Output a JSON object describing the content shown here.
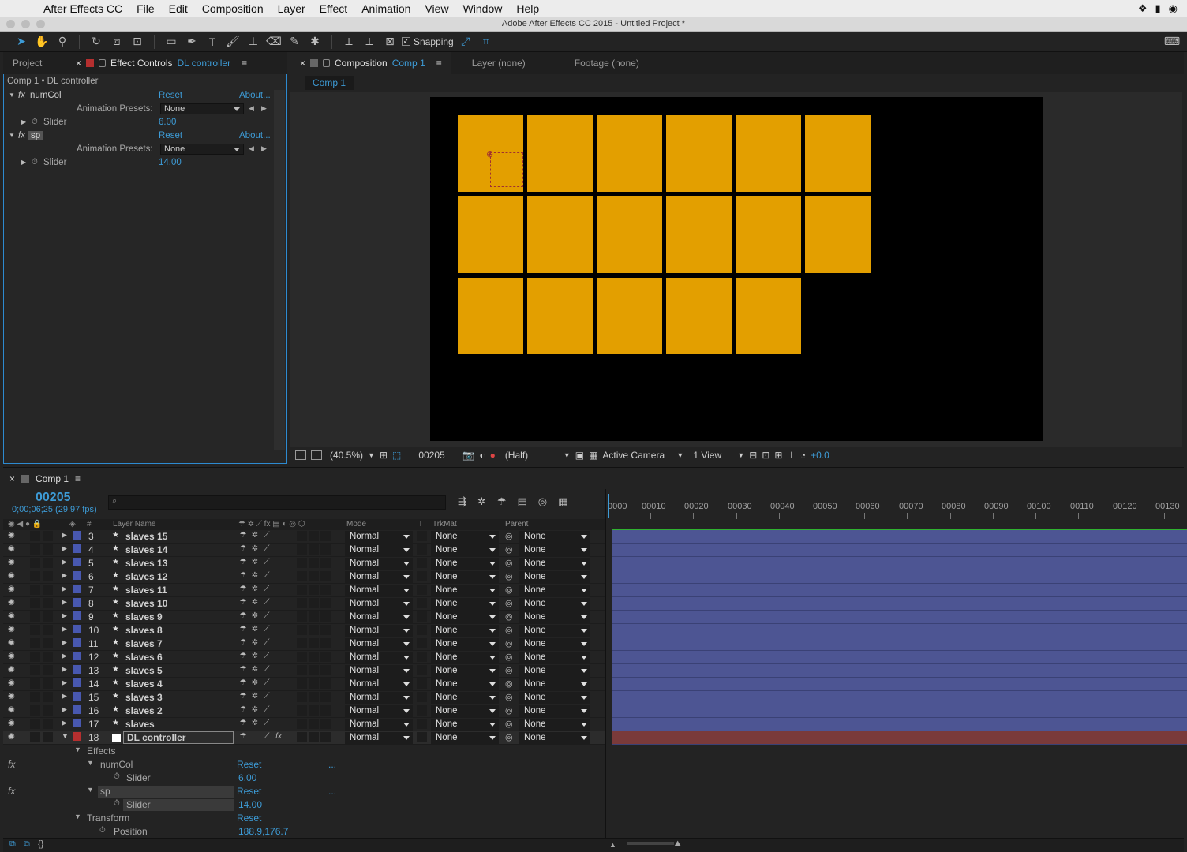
{
  "menubar": {
    "app": "After Effects CC",
    "items": [
      "File",
      "Edit",
      "Composition",
      "Layer",
      "Effect",
      "Animation",
      "View",
      "Window",
      "Help"
    ]
  },
  "window_title": "Adobe After Effects CC 2015 - Untitled Project *",
  "toolbar": {
    "snapping_label": "Snapping",
    "snapping_checked": true
  },
  "left_panel": {
    "tab_project": "Project",
    "tab_effect_controls": "Effect Controls",
    "tab_effect_controls_target": "DL controller",
    "breadcrumb": "Comp 1 • DL controller",
    "effects": [
      {
        "name": "numCol",
        "reset": "Reset",
        "about": "About...",
        "presets_label": "Animation Presets:",
        "preset_value": "None",
        "param_name": "Slider",
        "param_value": "6.00"
      },
      {
        "name": "sp",
        "reset": "Reset",
        "about": "About...",
        "presets_label": "Animation Presets:",
        "preset_value": "None",
        "param_name": "Slider",
        "param_value": "14.00"
      }
    ]
  },
  "comp_panel": {
    "tab_label": "Composition",
    "tab_target": "Comp 1",
    "tab_layer": "Layer (none)",
    "tab_footage": "Footage (none)",
    "flow_button": "Comp 1",
    "tile_color": "#e39f00",
    "footer": {
      "zoom": "(40.5%)",
      "frame": "00205",
      "resolution": "(Half)",
      "camera": "Active Camera",
      "views": "1 View",
      "exposure": "+0.0"
    }
  },
  "timeline": {
    "tab": "Comp 1",
    "timecode": "00205",
    "fps_text": "0;00;06;25 (29.97 fps)",
    "search_placeholder": "⌕",
    "columns": {
      "layer_name": "Layer Name",
      "num": "#",
      "mode": "Mode",
      "t": "T",
      "trkmat": "TrkMat",
      "parent": "Parent"
    },
    "ruler": [
      "0000",
      "00010",
      "00020",
      "00030",
      "00040",
      "00050",
      "00060",
      "00070",
      "00080",
      "00090",
      "00100",
      "00110",
      "00120",
      "00130"
    ],
    "layers": [
      {
        "num": "3",
        "name": "slaves 15",
        "mode": "Normal",
        "trkmat": "None",
        "parent": "None"
      },
      {
        "num": "4",
        "name": "slaves 14",
        "mode": "Normal",
        "trkmat": "None",
        "parent": "None"
      },
      {
        "num": "5",
        "name": "slaves 13",
        "mode": "Normal",
        "trkmat": "None",
        "parent": "None"
      },
      {
        "num": "6",
        "name": "slaves 12",
        "mode": "Normal",
        "trkmat": "None",
        "parent": "None"
      },
      {
        "num": "7",
        "name": "slaves 11",
        "mode": "Normal",
        "trkmat": "None",
        "parent": "None"
      },
      {
        "num": "8",
        "name": "slaves 10",
        "mode": "Normal",
        "trkmat": "None",
        "parent": "None"
      },
      {
        "num": "9",
        "name": "slaves 9",
        "mode": "Normal",
        "trkmat": "None",
        "parent": "None"
      },
      {
        "num": "10",
        "name": "slaves 8",
        "mode": "Normal",
        "trkmat": "None",
        "parent": "None"
      },
      {
        "num": "11",
        "name": "slaves 7",
        "mode": "Normal",
        "trkmat": "None",
        "parent": "None"
      },
      {
        "num": "12",
        "name": "slaves 6",
        "mode": "Normal",
        "trkmat": "None",
        "parent": "None"
      },
      {
        "num": "13",
        "name": "slaves 5",
        "mode": "Normal",
        "trkmat": "None",
        "parent": "None"
      },
      {
        "num": "14",
        "name": "slaves 4",
        "mode": "Normal",
        "trkmat": "None",
        "parent": "None"
      },
      {
        "num": "15",
        "name": "slaves 3",
        "mode": "Normal",
        "trkmat": "None",
        "parent": "None"
      },
      {
        "num": "16",
        "name": "slaves 2",
        "mode": "Normal",
        "trkmat": "None",
        "parent": "None"
      },
      {
        "num": "17",
        "name": "slaves",
        "mode": "Normal",
        "trkmat": "None",
        "parent": "None"
      },
      {
        "num": "18",
        "name": "DL controller",
        "mode": "Normal",
        "trkmat": "None",
        "parent": "None"
      }
    ],
    "props": {
      "effects_label": "Effects",
      "numcol_name": "numCol",
      "numcol_reset": "Reset",
      "numcol_dots": "...",
      "numcol_slider": "Slider",
      "numcol_value": "6.00",
      "sp_name": "sp",
      "sp_reset": "Reset",
      "sp_dots": "...",
      "sp_slider": "Slider",
      "sp_value": "14.00",
      "transform_label": "Transform",
      "transform_reset": "Reset",
      "position_label": "Position",
      "position_value": "188.9,176.7"
    }
  }
}
